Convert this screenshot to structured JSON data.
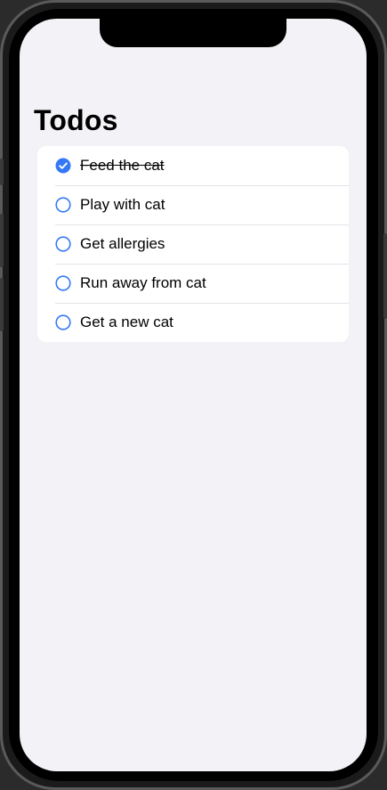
{
  "app": {
    "title": "Todos"
  },
  "colors": {
    "accent": "#3478f6",
    "background": "#f2f2f7",
    "card": "#ffffff",
    "separator": "#e3e3e8"
  },
  "todos": [
    {
      "label": "Feed the cat",
      "done": true,
      "icon": "checkmark-circle-filled-icon"
    },
    {
      "label": "Play with cat",
      "done": false,
      "icon": "circle-icon"
    },
    {
      "label": "Get allergies",
      "done": false,
      "icon": "circle-icon"
    },
    {
      "label": "Run away from cat",
      "done": false,
      "icon": "circle-icon"
    },
    {
      "label": "Get a new cat",
      "done": false,
      "icon": "circle-icon"
    }
  ]
}
